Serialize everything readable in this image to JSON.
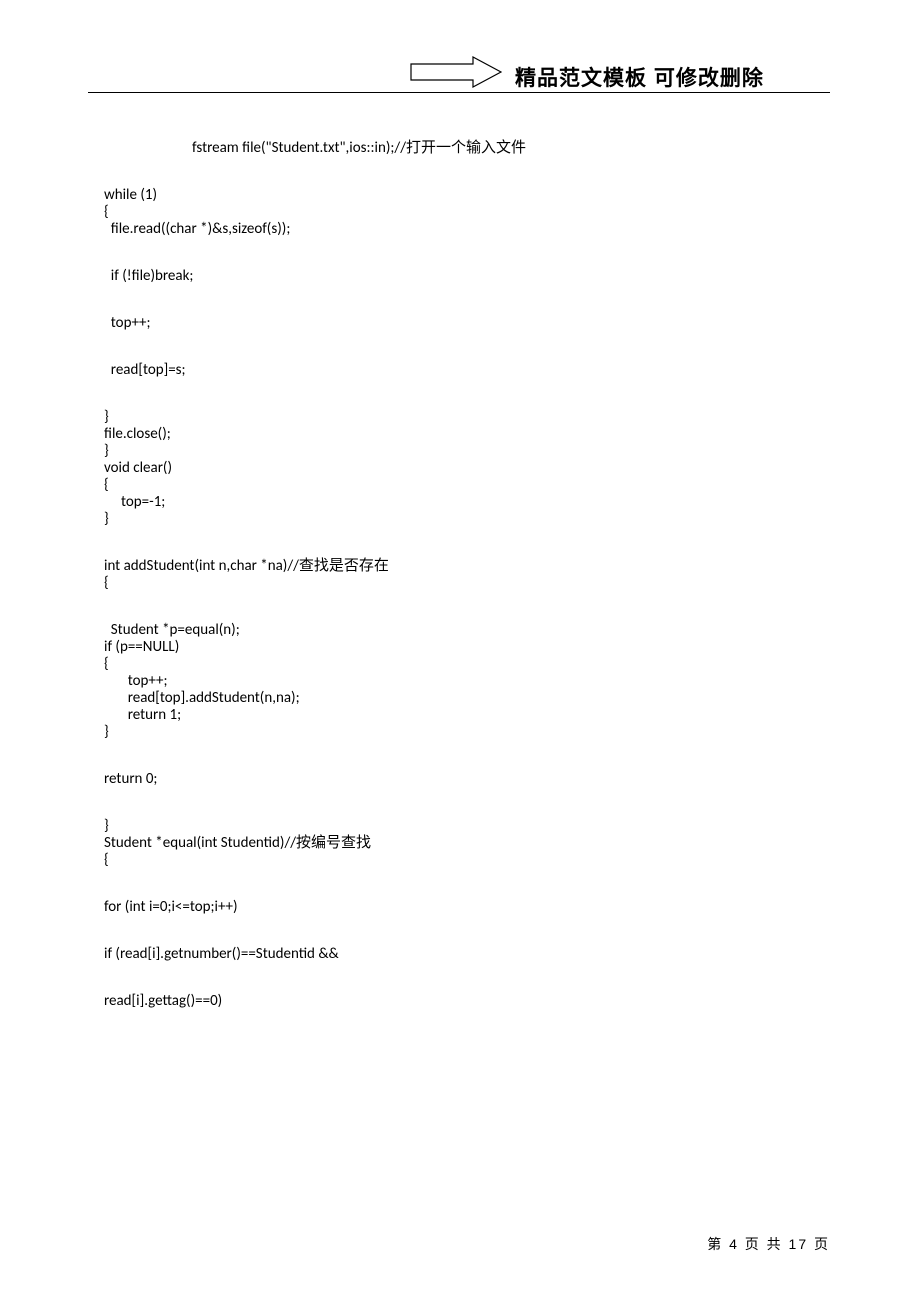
{
  "header": {
    "title": "精品范文模板  可修改删除"
  },
  "code": {
    "l1": "fstream file(\"Student.txt\",ios::in);//打开一个输入文件",
    "l2": "while (1)",
    "l3": "{",
    "l4": "  file.read((char *)&s,sizeof(s));",
    "l5": "  if (!file)break;",
    "l6": "  top++;",
    "l7": "  read[top]=s;",
    "l8": "}",
    "l9": "file.close();",
    "l10": "}",
    "l11": "void clear()",
    "l12": "{",
    "l13": "     top=-1;",
    "l14": "}",
    "l15": "int addStudent(int n,char *na)//查找是否存在",
    "l16": "{",
    "l17": "  Student *p=equal(n);",
    "l18": "if (p==NULL)",
    "l19": "{",
    "l20": "       top++;",
    "l21": "       read[top].addStudent(n,na);",
    "l22": "       return 1;",
    "l23": "}",
    "l24": "return 0;",
    "l25": "}",
    "l26": "Student *equal(int Studentid)//按编号查找",
    "l27": "{",
    "l28": "for (int i=0;i<=top;i++)",
    "l29": "if (read[i].getnumber()==Studentid &&",
    "l30": "read[i].gettag()==0)"
  },
  "footer": {
    "page_text": "第 4 页 共 17 页",
    "current_page": 4,
    "total_pages": 17
  }
}
